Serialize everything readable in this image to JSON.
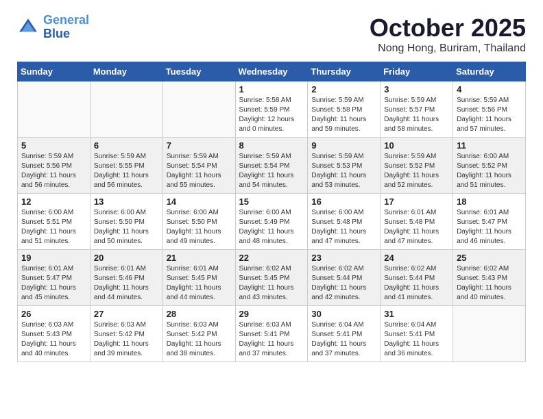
{
  "header": {
    "logo_line1": "General",
    "logo_line2": "Blue",
    "month": "October 2025",
    "location": "Nong Hong, Buriram, Thailand"
  },
  "weekdays": [
    "Sunday",
    "Monday",
    "Tuesday",
    "Wednesday",
    "Thursday",
    "Friday",
    "Saturday"
  ],
  "weeks": [
    {
      "shaded": false,
      "days": [
        {
          "num": "",
          "info": ""
        },
        {
          "num": "",
          "info": ""
        },
        {
          "num": "",
          "info": ""
        },
        {
          "num": "1",
          "info": "Sunrise: 5:58 AM\nSunset: 5:59 PM\nDaylight: 12 hours\nand 0 minutes."
        },
        {
          "num": "2",
          "info": "Sunrise: 5:59 AM\nSunset: 5:58 PM\nDaylight: 11 hours\nand 59 minutes."
        },
        {
          "num": "3",
          "info": "Sunrise: 5:59 AM\nSunset: 5:57 PM\nDaylight: 11 hours\nand 58 minutes."
        },
        {
          "num": "4",
          "info": "Sunrise: 5:59 AM\nSunset: 5:56 PM\nDaylight: 11 hours\nand 57 minutes."
        }
      ]
    },
    {
      "shaded": true,
      "days": [
        {
          "num": "5",
          "info": "Sunrise: 5:59 AM\nSunset: 5:56 PM\nDaylight: 11 hours\nand 56 minutes."
        },
        {
          "num": "6",
          "info": "Sunrise: 5:59 AM\nSunset: 5:55 PM\nDaylight: 11 hours\nand 56 minutes."
        },
        {
          "num": "7",
          "info": "Sunrise: 5:59 AM\nSunset: 5:54 PM\nDaylight: 11 hours\nand 55 minutes."
        },
        {
          "num": "8",
          "info": "Sunrise: 5:59 AM\nSunset: 5:54 PM\nDaylight: 11 hours\nand 54 minutes."
        },
        {
          "num": "9",
          "info": "Sunrise: 5:59 AM\nSunset: 5:53 PM\nDaylight: 11 hours\nand 53 minutes."
        },
        {
          "num": "10",
          "info": "Sunrise: 5:59 AM\nSunset: 5:52 PM\nDaylight: 11 hours\nand 52 minutes."
        },
        {
          "num": "11",
          "info": "Sunrise: 6:00 AM\nSunset: 5:52 PM\nDaylight: 11 hours\nand 51 minutes."
        }
      ]
    },
    {
      "shaded": false,
      "days": [
        {
          "num": "12",
          "info": "Sunrise: 6:00 AM\nSunset: 5:51 PM\nDaylight: 11 hours\nand 51 minutes."
        },
        {
          "num": "13",
          "info": "Sunrise: 6:00 AM\nSunset: 5:50 PM\nDaylight: 11 hours\nand 50 minutes."
        },
        {
          "num": "14",
          "info": "Sunrise: 6:00 AM\nSunset: 5:50 PM\nDaylight: 11 hours\nand 49 minutes."
        },
        {
          "num": "15",
          "info": "Sunrise: 6:00 AM\nSunset: 5:49 PM\nDaylight: 11 hours\nand 48 minutes."
        },
        {
          "num": "16",
          "info": "Sunrise: 6:00 AM\nSunset: 5:48 PM\nDaylight: 11 hours\nand 47 minutes."
        },
        {
          "num": "17",
          "info": "Sunrise: 6:01 AM\nSunset: 5:48 PM\nDaylight: 11 hours\nand 47 minutes."
        },
        {
          "num": "18",
          "info": "Sunrise: 6:01 AM\nSunset: 5:47 PM\nDaylight: 11 hours\nand 46 minutes."
        }
      ]
    },
    {
      "shaded": true,
      "days": [
        {
          "num": "19",
          "info": "Sunrise: 6:01 AM\nSunset: 5:47 PM\nDaylight: 11 hours\nand 45 minutes."
        },
        {
          "num": "20",
          "info": "Sunrise: 6:01 AM\nSunset: 5:46 PM\nDaylight: 11 hours\nand 44 minutes."
        },
        {
          "num": "21",
          "info": "Sunrise: 6:01 AM\nSunset: 5:45 PM\nDaylight: 11 hours\nand 44 minutes."
        },
        {
          "num": "22",
          "info": "Sunrise: 6:02 AM\nSunset: 5:45 PM\nDaylight: 11 hours\nand 43 minutes."
        },
        {
          "num": "23",
          "info": "Sunrise: 6:02 AM\nSunset: 5:44 PM\nDaylight: 11 hours\nand 42 minutes."
        },
        {
          "num": "24",
          "info": "Sunrise: 6:02 AM\nSunset: 5:44 PM\nDaylight: 11 hours\nand 41 minutes."
        },
        {
          "num": "25",
          "info": "Sunrise: 6:02 AM\nSunset: 5:43 PM\nDaylight: 11 hours\nand 40 minutes."
        }
      ]
    },
    {
      "shaded": false,
      "days": [
        {
          "num": "26",
          "info": "Sunrise: 6:03 AM\nSunset: 5:43 PM\nDaylight: 11 hours\nand 40 minutes."
        },
        {
          "num": "27",
          "info": "Sunrise: 6:03 AM\nSunset: 5:42 PM\nDaylight: 11 hours\nand 39 minutes."
        },
        {
          "num": "28",
          "info": "Sunrise: 6:03 AM\nSunset: 5:42 PM\nDaylight: 11 hours\nand 38 minutes."
        },
        {
          "num": "29",
          "info": "Sunrise: 6:03 AM\nSunset: 5:41 PM\nDaylight: 11 hours\nand 37 minutes."
        },
        {
          "num": "30",
          "info": "Sunrise: 6:04 AM\nSunset: 5:41 PM\nDaylight: 11 hours\nand 37 minutes."
        },
        {
          "num": "31",
          "info": "Sunrise: 6:04 AM\nSunset: 5:41 PM\nDaylight: 11 hours\nand 36 minutes."
        },
        {
          "num": "",
          "info": ""
        }
      ]
    }
  ]
}
